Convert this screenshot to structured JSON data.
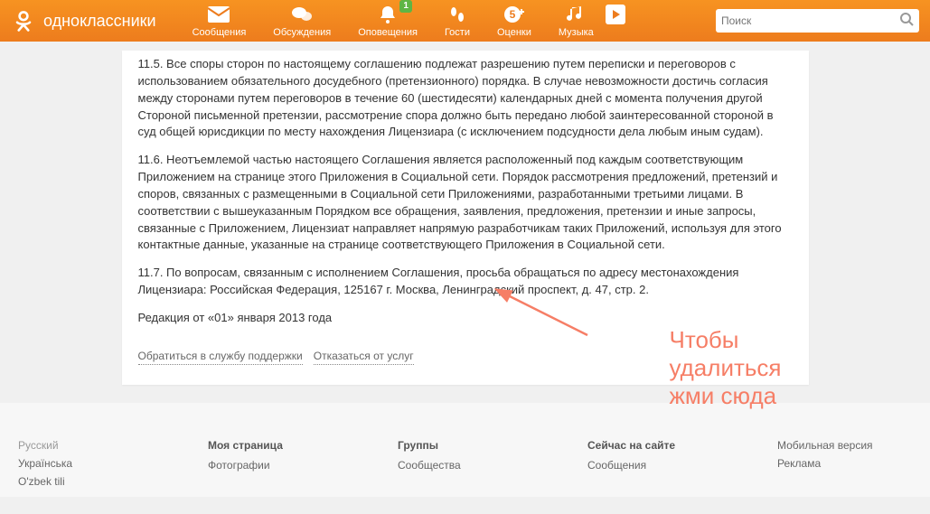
{
  "brand": "одноклассники",
  "nav": {
    "messages": "Сообщения",
    "discussions": "Обсуждения",
    "notifications": "Оповещения",
    "notifications_badge": "1",
    "guests": "Гости",
    "ratings": "Оценки",
    "music": "Музыка"
  },
  "search": {
    "placeholder": "Поиск"
  },
  "agreement": {
    "p115": "11.5. Все споры сторон по настоящему соглашению подлежат разрешению путем переписки и переговоров с использованием обязательного досудебного (претензионного) порядка. В случае невозможности достичь согласия между сторонами путем переговоров в течение 60 (шестидесяти) календарных дней с момента получения другой Стороной письменной претензии, рассмотрение спора должно быть передано любой заинтересованной стороной в суд общей юрисдикции по месту нахождения Лицензиара (с исключением подсудности дела любым иным судам).",
    "p116": "11.6. Неотъемлемой частью настоящего Соглашения является расположенный под каждым соответствующим Приложением на странице этого Приложения в Социальной сети. Порядок рассмотрения предложений, претензий и споров, связанных с размещенными в Социальной сети Приложениями, разработанными третьими лицами. В соответствии с вышеуказанным Порядком все обращения, заявления, предложения, претензии и иные запросы, связанные с Приложением, Лицензиат направляет напрямую разработчикам таких Приложений, используя для этого контактные данные, указанные на странице соответствующего Приложения в Социальной сети.",
    "p117": "11.7. По вопросам, связанным с исполнением Соглашения, просьба обращаться по адресу местонахождения Лицензиара: Российская Федерация, 125167 г. Москва, Ленинградский проспект, д. 47, стр. 2.",
    "revision": "Редакция от «01» января 2013 года"
  },
  "actions": {
    "support": "Обратиться в службу поддержки",
    "decline": "Отказаться от услуг"
  },
  "annotation": {
    "line1": "Чтобы",
    "line2": "удалиться",
    "line3": "жми сюда"
  },
  "footer": {
    "langs": {
      "current": "Русский",
      "uk": "Українська",
      "uz": "O'zbek tili"
    },
    "col1": {
      "heading": "Моя страница",
      "photos": "Фотографии"
    },
    "col2": {
      "heading": "Группы",
      "communities": "Сообщества"
    },
    "col3": {
      "heading": "Сейчас на сайте",
      "messages": "Сообщения"
    },
    "col4": {
      "mobile": "Мобильная версия",
      "ads": "Реклама"
    }
  }
}
